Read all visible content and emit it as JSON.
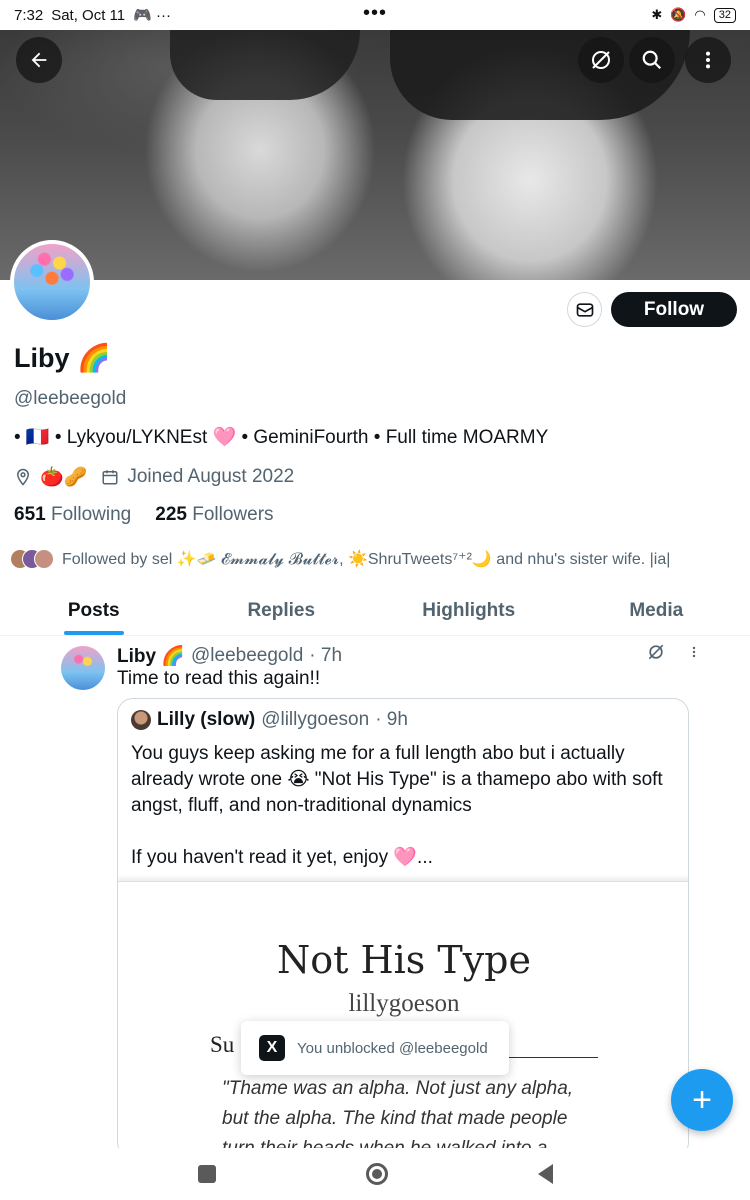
{
  "status_bar": {
    "time": "7:32",
    "date": "Sat, Oct 11",
    "overflow": "•••",
    "battery": "32"
  },
  "banner": {
    "icons": [
      "back-arrow-icon",
      "grok-icon",
      "search-icon",
      "more-vertical-icon"
    ]
  },
  "profile": {
    "name": "Liby 🌈",
    "handle": "@leebeegold",
    "bio": "• 🇫🇷 • Lykyou/LYKNEst 🩷 • GeminiFourth • Full time MOARMY",
    "location": "🍅🥜",
    "joined": "Joined August 2022",
    "following_count": "651",
    "following_label": "Following",
    "followers_count": "225",
    "followers_label": "Followers",
    "followed_by": "Followed by sel ✨🧈 𝓔𝓶𝓶𝓪𝓵𝔂 𝓑𝓾𝓽𝓽𝓮𝓻, ☀️ShruTweets⁷⁺²🌙 and nhu's sister wife. |ia|",
    "follow_button": "Follow"
  },
  "tabs": [
    {
      "label": "Posts",
      "active": true
    },
    {
      "label": "Replies",
      "active": false
    },
    {
      "label": "Highlights",
      "active": false
    },
    {
      "label": "Media",
      "active": false
    }
  ],
  "post": {
    "author": "Liby 🌈",
    "handle": "@leebeegold",
    "time": "· 7h",
    "text": "Time to read this again!!",
    "quote": {
      "author": "Lilly (slow)",
      "handle": "@lillygoeson",
      "time": "· 9h",
      "text1": "You guys keep asking me for a full length abo but i actually already wrote one 😭 \"Not His Type\" is a thamepo abo with soft angst, fluff, and non-traditional dynamics",
      "text2": "If you haven't read it yet, enjoy 🩷...",
      "image": {
        "title": "Not His Type",
        "author": "lillygoeson",
        "summary_label": "Su",
        "excerpt": "\"Thame was an alpha. Not just any alpha, but the alpha. The kind that made people turn their heads when he walked into a"
      }
    }
  },
  "toast": {
    "icon": "X",
    "text": "You unblocked @leebeegold"
  },
  "fab": {
    "label": "+"
  }
}
